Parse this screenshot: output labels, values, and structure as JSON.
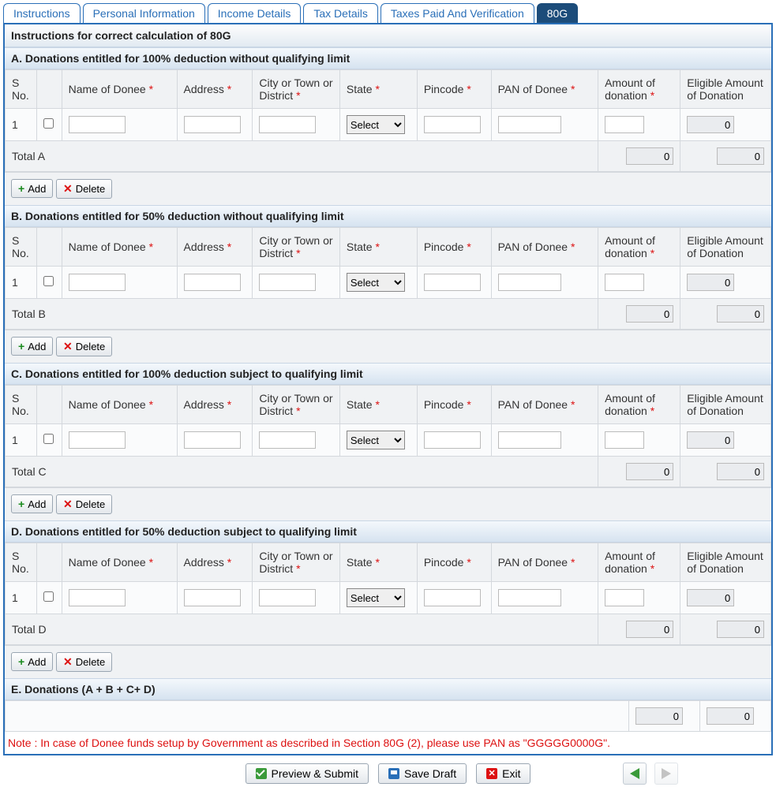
{
  "tabs": [
    "Instructions",
    "Personal Information",
    "Income Details",
    "Tax Details",
    "Taxes Paid And Verification",
    "80G"
  ],
  "activeTab": "80G",
  "title": "Instructions for correct calculation of 80G",
  "columns": {
    "sno": "S No.",
    "donee": "Name of Donee",
    "address": "Address",
    "city": "City or Town or District",
    "state": "State",
    "pincode": "Pincode",
    "pan": "PAN of Donee",
    "amount": "Amount of donation",
    "eligible": "Eligible Amount of Donation"
  },
  "stateSelect": "Select",
  "sections": {
    "A": {
      "heading": "A. Donations entitled for 100% deduction without qualifying limit",
      "rowNo": "1",
      "eligible": "0",
      "totalLabel": "Total A",
      "totalAmount": "0",
      "totalEligible": "0"
    },
    "B": {
      "heading": "B. Donations entitled for 50% deduction without qualifying limit",
      "rowNo": "1",
      "eligible": "0",
      "totalLabel": "Total B",
      "totalAmount": "0",
      "totalEligible": "0"
    },
    "C": {
      "heading": "C. Donations entitled for 100% deduction subject to qualifying limit",
      "rowNo": "1",
      "eligible": "0",
      "totalLabel": "Total C",
      "totalAmount": "0",
      "totalEligible": "0"
    },
    "D": {
      "heading": "D. Donations entitled for 50% deduction subject to qualifying limit",
      "rowNo": "1",
      "eligible": "0",
      "totalLabel": "Total D",
      "totalAmount": "0",
      "totalEligible": "0"
    }
  },
  "sectionE": {
    "heading": "E. Donations (A + B + C+ D)",
    "amount": "0",
    "eligible": "0"
  },
  "buttons": {
    "add": "Add",
    "delete": "Delete",
    "preview": "Preview & Submit",
    "save": "Save Draft",
    "exit": "Exit"
  },
  "note": "Note :   In case of Donee funds setup by Government as described in Section 80G (2), please use PAN as \"GGGGG0000G\"."
}
